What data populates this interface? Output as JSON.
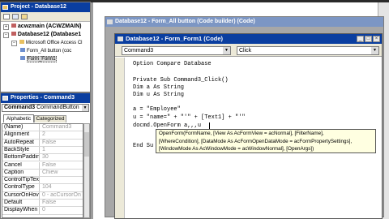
{
  "project": {
    "title": "Project - Database12",
    "tree": [
      {
        "label": "acwzmain (ACWZMAIN)"
      },
      {
        "label": "Database12 (Database1"
      },
      {
        "label": "Microsoft Office Access Cl"
      },
      {
        "label": "Form_All button (coc"
      },
      {
        "label": "Form_Form1"
      }
    ]
  },
  "properties": {
    "title": "Properties - Command3",
    "object": "Command3",
    "object_type": "CommandButton",
    "tab_alphabetic": "Alphabetic",
    "tab_categorized": "Categorized",
    "rows": [
      {
        "key": "(Name)",
        "value": "Command3"
      },
      {
        "key": "Alignment",
        "value": "2"
      },
      {
        "key": "AutoRepeat",
        "value": "False"
      },
      {
        "key": "BackStyle",
        "value": "1"
      },
      {
        "key": "BottomPadding",
        "value": "30"
      },
      {
        "key": "Cancel",
        "value": "False"
      },
      {
        "key": "Caption",
        "value": "Chiew"
      },
      {
        "key": "ControlTipText",
        "value": ""
      },
      {
        "key": "ControlType",
        "value": "104"
      },
      {
        "key": "CursorOnHover",
        "value": "0 - acCursorOn"
      },
      {
        "key": "Default",
        "value": "False"
      },
      {
        "key": "DisplayWhen",
        "value": "0"
      }
    ]
  },
  "back_window": {
    "title": "Database12 - Form_All button (Code builder) (Code)"
  },
  "code_window": {
    "title": "Database12 - Form_Form1 (Code)",
    "object_select": "Command3",
    "proc_select": "Click",
    "lines": [
      "Option Compare Database",
      "",
      "Private Sub Command3_Click()",
      "Dim a As String",
      "Dim u As String",
      "",
      "a = \"Employee\"",
      "u = \"name=\" + \"'\" + [Text1] + \"'\"",
      "docmd.OpenForm a,,,u",
      "",
      "",
      "End Su"
    ]
  },
  "tooltip": {
    "line1": "OpenForm(FormName, [View As AcFormView = acNormal], [FilterName],",
    "line2": "[WhereCondition], [DataMode As AcFormOpenDataMode = acFormPropertySettings],",
    "line3": "[WindowMode As AcWindowMode = acWindowNormal], [OpenArgs])"
  },
  "colors": {
    "title_active": "#0a3ea0",
    "title_inactive": "#7c96c4",
    "desktop": "#8a8a8a",
    "tooltip_bg": "#ffffe1"
  }
}
